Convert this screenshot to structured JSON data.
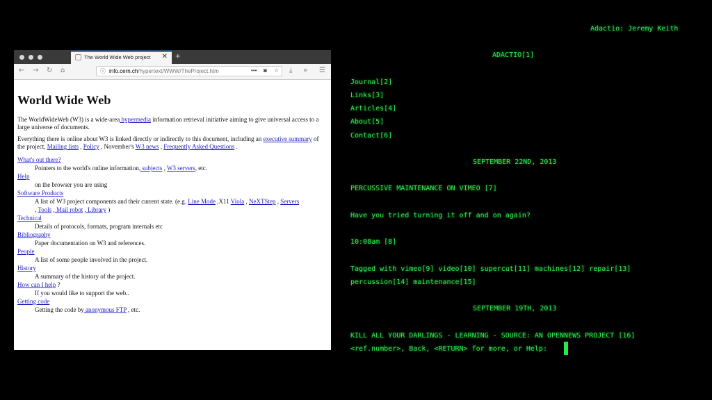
{
  "speaker": "Adactio: Jeremy Keith",
  "browser": {
    "tab_title": "The World Wide Web project",
    "tab_close": "✕",
    "new_tab": "+",
    "url_host": "info.cern.ch",
    "url_path": "/hypertext/WWW/TheProject.htm",
    "icons": [
      "back-icon",
      "forward-icon",
      "reload-icon",
      "home-icon",
      "info-icon",
      "more-icon",
      "pocket-icon",
      "star-icon",
      "download-icon",
      "overflow-icon",
      "menu-icon"
    ]
  },
  "page": {
    "title": "World Wide Web",
    "intro": {
      "t1": "The WorldWideWeb (W3) is a wide-area",
      "link": " hypermedia",
      "t2": " information retrieval initiative aiming to give universal access to a large universe of documents."
    },
    "everything": {
      "t1": "Everything there is online about W3 is linked directly or indirectly to this document, including an ",
      "l1": "executive summary",
      "t2": " of the project, ",
      "l2": "Mailing lists",
      "t3": " , ",
      "l3": "Policy",
      "t4": " , November's ",
      "l4": "W3 news",
      "t5": " , ",
      "l5": "Frequently Asked Questions",
      "t6": " ."
    },
    "whats_out": {
      "term": "What's out there?",
      "d1": "Pointers to the world's online information,",
      "l1": " subjects",
      "d2": " , ",
      "l2": "W3 servers",
      "d3": ", etc."
    },
    "help": {
      "term": "Help",
      "desc": "on the browser you are using"
    },
    "software": {
      "term": "Software Products",
      "d1": "A list of W3 project components and their current state. (e.g. ",
      "l1": "Line Mode",
      "d2": " ,X11 ",
      "l2": "Viola",
      "d3": " , ",
      "l3": "NeXTStep",
      "d4": " , ",
      "l4": "Servers",
      "d5": " , ",
      "l5": "Tools",
      "d6": " ,",
      "l6": " Mail robot",
      "d7": " ,",
      "l7": " Library",
      "d8": " )"
    },
    "technical": {
      "term": "Technical",
      "desc": "Details of protocols, formats, program internals etc"
    },
    "bibliography": {
      "term": "Bibliography",
      "desc": "Paper documentation on W3 and references."
    },
    "people": {
      "term": "People",
      "desc": "A list of some people involved in the project."
    },
    "history": {
      "term": "History",
      "desc": "A summary of the history of the project."
    },
    "how_help": {
      "term": "How can I help",
      "term_suffix": " ?",
      "desc": "If you would like to support the web.."
    },
    "getting_code": {
      "term": "Getting code",
      "d1": "Getting the code by",
      "l1": " anonymous FTP",
      "d2": " , etc."
    }
  },
  "terminal": {
    "header": "ADACTIO[1]",
    "nav": [
      "Journal[2]",
      "Links[3]",
      "Articles[4]",
      "About[5]",
      "Contact[6]"
    ],
    "date1": "SEPTEMBER 22ND, 2013",
    "post_title": "PERCUSSIVE MAINTENANCE ON VIMEO [7]",
    "post_body": "Have you tried turning it off and on again?",
    "post_time": "10:08am [8]",
    "tags1": "Tagged with vimeo[9] video[10] supercut[11] machines[12] repair[13]",
    "tags2": "percussion[14] maintenance[15]",
    "date2": "SEPTEMBER 19TH, 2013",
    "post2_title": "KILL ALL YOUR DARLINGS - LEARNING - SOURCE: AN OPENNEWS PROJECT [16]",
    "prompt": "<ref.number>, Back, <RETURN> for more, or Help:"
  }
}
